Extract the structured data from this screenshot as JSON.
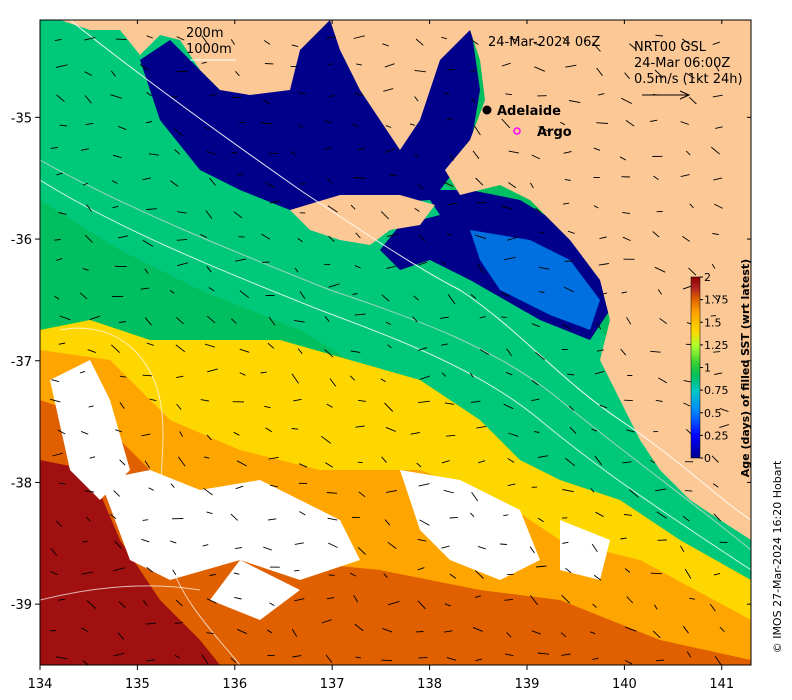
{
  "map": {
    "date_title": "24-Mar-2024 06Z",
    "contour_legend": [
      "200m",
      "1000m"
    ],
    "current_source": [
      "NRT00 GSL",
      "24-Mar 06:00Z",
      "0.5m/s (1kt 24h)"
    ],
    "places": [
      {
        "name": "Adelaide",
        "lon": 138.6,
        "lat": -34.93,
        "marker": "filled-circle",
        "color": "#000000"
      },
      {
        "name": "Argo",
        "lon": 138.87,
        "lat": -35.11,
        "marker": "open-circle",
        "color": "#ff00ff"
      }
    ],
    "credit": "© IMOS 27-Mar-2024 16:20 Hobart",
    "extent": {
      "lon": [
        134.0,
        141.3
      ],
      "lat": [
        -39.5,
        -34.2
      ]
    },
    "x_ticks": [
      "134",
      "135",
      "136",
      "137",
      "138",
      "139",
      "140",
      "141"
    ],
    "y_ticks": [
      "-35",
      "-36",
      "-37",
      "-38",
      "-39"
    ],
    "land_color": "#fcc896",
    "nodata_color": "#ffffff"
  },
  "colorbar": {
    "title": "Age (days) of filled SST (wrt latest)",
    "range": [
      0,
      2
    ],
    "ticks": [
      "0",
      "0.25",
      "0.5",
      "0.75",
      "1",
      "1.25",
      "1.5",
      "1.75",
      "2"
    ],
    "colors": [
      "#00008b",
      "#0000ff",
      "#0080ff",
      "#00c8c8",
      "#00bf60",
      "#32cd32",
      "#adff2f",
      "#ffd700",
      "#ffa500",
      "#e06000",
      "#b22222",
      "#8b0000"
    ]
  }
}
